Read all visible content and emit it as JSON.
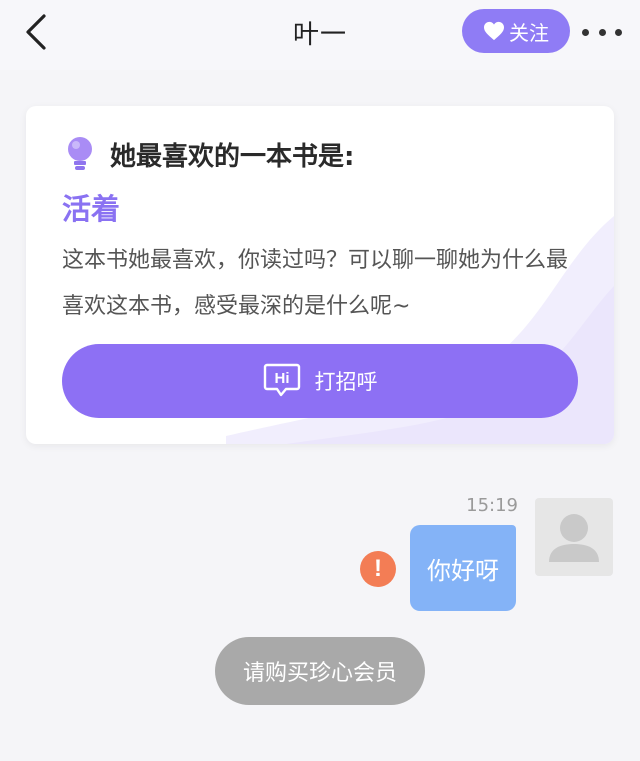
{
  "header": {
    "title": "叶一",
    "follow_label": "关注"
  },
  "card": {
    "heading": "她最喜欢的一本书是:",
    "book": "活着",
    "description": "这本书她最喜欢，你读过吗？可以聊一聊她为什么最喜欢这本书，感受最深的是什么呢~",
    "button_label": "打招呼",
    "hi_icon_text": "Hi"
  },
  "chat": {
    "time": "15:19",
    "message": "你好呀",
    "error_mark": "!",
    "notice": "请购买珍心会员"
  },
  "colors": {
    "accent": "#8d70f4",
    "bubble": "#84b3f7",
    "error": "#f37d55",
    "notice": "#a9a9a9"
  }
}
